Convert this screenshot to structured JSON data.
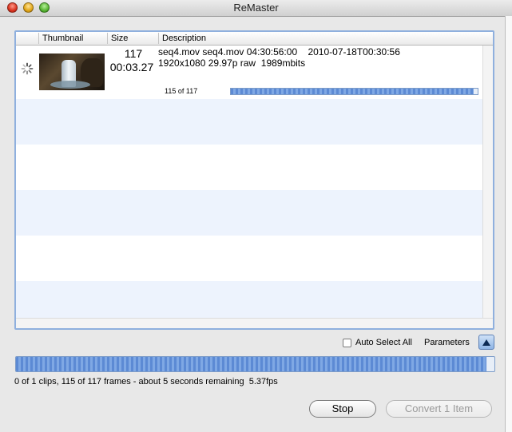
{
  "window": {
    "title": "ReMaster"
  },
  "table": {
    "columns": [
      "Thumbnail",
      "Size",
      "Description"
    ],
    "clip": {
      "frames": "117",
      "duration": "00:03.27",
      "description_line1": "seq4.mov seq4.mov 04:30:56:00    2010-07-18T00:30:56",
      "description_line2": "1920x1080 29.97p raw  1989mbits",
      "progress_label": "115 of 117",
      "progress_fraction": 0.983
    }
  },
  "controls": {
    "auto_select_label": "Auto Select All",
    "auto_select_checked": false,
    "parameters_label": "Parameters",
    "parameters_icon": "triangle-up-icon"
  },
  "overall_progress_fraction": 0.983,
  "status_text": "0 of 1 clips, 115 of 117 frames - about 5 seconds remaining  5.37fps",
  "buttons": {
    "stop": "Stop",
    "convert": "Convert 1 Item"
  },
  "colors": {
    "selection_blue": "#8fb0de",
    "stripe_blue": "#edf3fd",
    "progress_blue": "#5c8ad4"
  }
}
